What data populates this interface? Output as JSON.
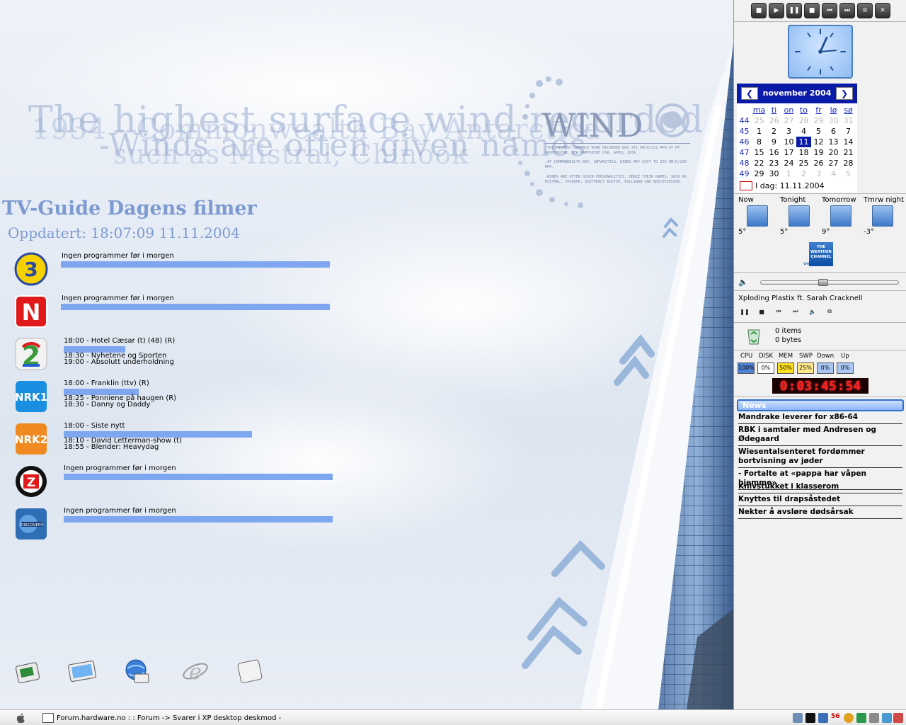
{
  "wallpaper": {
    "bg_text_1": "The highest surface wind recorded",
    "bg_text_2": "1934 - Commonwealth Bay Antarctica",
    "bg_text_3": "-Winds are often given names",
    "bg_text_4": "such as Mistral, Chinook",
    "wind_logo": "WIND",
    "wind_para_1": "-The highest surface wind recorded was 371 km/h/231 mph at Mt. Washington, New Hampshire USA, April 1934.",
    "wind_para_2": "-At Commonwealth Bay, Antarctica, winds may gust to 320 km/h/200 mph.",
    "wind_para_3": "-Winds are often given personalities, hence their names, such as Mistral, Chinook, Southerly Buster, Williwaw and Brickfielder."
  },
  "tvguide": {
    "title": "TV-Guide  Dagens filmer",
    "updated": "Oppdatert: 18:07:09 11.11.2004",
    "channels": [
      {
        "logo": "TV3",
        "lines": [
          "Ingen programmer før i morgen"
        ],
        "progress": 100
      },
      {
        "logo": "TVN",
        "lines": [
          "Ingen programmer før i morgen"
        ],
        "progress": 100
      },
      {
        "logo": "TV2",
        "lines": [
          "18:00 - Hotel Cæsar (t)  (48) (R)",
          "18:30 - Nyhetene og Sporten",
          "19:00 - Absolutt underholdning"
        ],
        "progress": 23
      },
      {
        "logo": "NRK1",
        "lines": [
          "18:00 - Franklin (ttv) (R)",
          "18:25 - Ponniene på haugen (R)",
          "18:30 - Danny og Daddy"
        ],
        "progress": 28
      },
      {
        "logo": "NRK2",
        "lines": [
          "18:00 - Siste nytt",
          "18:10 - David Letterman-show (t)",
          "18:55 - Blender: Heavydag"
        ],
        "progress": 70
      },
      {
        "logo": "Z",
        "lines": [
          "Ingen programmer før i morgen"
        ],
        "progress": 100
      },
      {
        "logo": "Discovery",
        "lines": [
          "Ingen programmer før i morgen"
        ],
        "progress": 100
      }
    ]
  },
  "dock": {
    "items": [
      "tv-tuner-icon",
      "monitor-icon",
      "network-globe-icon",
      "internet-explorer-icon",
      "drive-icon"
    ]
  },
  "taskbar": {
    "task_label": "Forum.hardware.no : : Forum -> Svarer i XP desktop deskmod -",
    "tray_badge": "56"
  },
  "sidebar": {
    "media_buttons": [
      "open",
      "play",
      "pause",
      "stop",
      "previous",
      "next",
      "playlist",
      "close"
    ],
    "calendar": {
      "month": "november 2004",
      "dow": [
        "ma",
        "ti",
        "on",
        "to",
        "fr",
        "lø",
        "sø"
      ],
      "weeks": [
        {
          "wk": "44",
          "days": [
            "25",
            "26",
            "27",
            "28",
            "29",
            "30",
            "31"
          ]
        },
        {
          "wk": "45",
          "days": [
            "1",
            "2",
            "3",
            "4",
            "5",
            "6",
            "7"
          ]
        },
        {
          "wk": "46",
          "days": [
            "8",
            "9",
            "10",
            "11",
            "12",
            "13",
            "14"
          ]
        },
        {
          "wk": "47",
          "days": [
            "15",
            "16",
            "17",
            "18",
            "19",
            "20",
            "21"
          ]
        },
        {
          "wk": "48",
          "days": [
            "22",
            "23",
            "24",
            "25",
            "26",
            "27",
            "28"
          ]
        },
        {
          "wk": "49",
          "days": [
            "29",
            "30",
            "1",
            "2",
            "3",
            "4",
            "5"
          ]
        }
      ],
      "today_label": "I dag: 11.11.2004"
    },
    "weather": [
      {
        "label": "Now",
        "temp": "5°"
      },
      {
        "label": "Tonight",
        "temp": "5°"
      },
      {
        "label": "Tomorrow",
        "temp": "9°"
      },
      {
        "label": "Tmrw night",
        "temp": "-3°"
      }
    ],
    "twc_logo": "THE WEATHER CHANNEL",
    "twc_url": "weather.com",
    "volume": 45,
    "now_playing": "Xploding Plastix ft. Sarah Cracknell",
    "recycle": {
      "items": "0 items",
      "bytes": "0 bytes"
    },
    "system": [
      {
        "label": "CPU",
        "value": "100%",
        "color": "#4f83d8"
      },
      {
        "label": "DISK",
        "value": "0%",
        "color": "#ffffff"
      },
      {
        "label": "MEM",
        "value": "50%",
        "color": "#ffe020"
      },
      {
        "label": "SWP",
        "value": "25%",
        "color": "#ffe98a"
      },
      {
        "label": "Down",
        "value": "0%",
        "color": "#a9c6f5"
      },
      {
        "label": "Up",
        "value": "0%",
        "color": "#a9c6f5"
      }
    ],
    "timer": [
      "0",
      "03",
      "45",
      "54"
    ],
    "news": {
      "header": "News",
      "items": [
        "Mandrake leverer for x86-64",
        "RBK i samtaler med Andresen og Ødegaard",
        "Wiesentalsenteret fordømmer bortvisning av jøder",
        "- Fortalte at «pappa har våpen hjemme»",
        "Knivstukket i klasserom",
        "Knyttes til drapsåstedet",
        "Nekter å avsløre dødsårsak"
      ]
    }
  }
}
